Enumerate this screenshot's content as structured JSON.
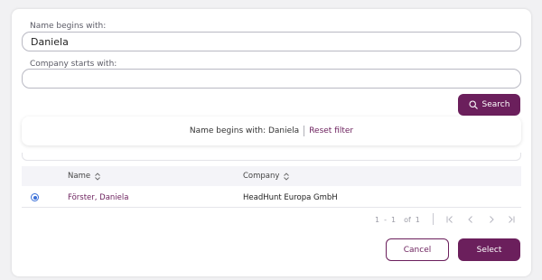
{
  "form": {
    "name_label": "Name begins with:",
    "name_value": "Daniela",
    "company_label": "Company starts with:",
    "company_value": "",
    "search_label": "Search"
  },
  "filter": {
    "text": "Name begins with: Daniela",
    "reset_label": "Reset filter"
  },
  "table": {
    "columns": [
      "Name",
      "Company"
    ],
    "rows": [
      {
        "selected": true,
        "name": "Förster, Daniela",
        "company": "HeadHunt Europa GmbH"
      }
    ]
  },
  "pagination": {
    "range_start": "1",
    "dash": "-",
    "range_end": "1",
    "of_label": "of",
    "total": "1"
  },
  "actions": {
    "cancel_label": "Cancel",
    "select_label": "Select"
  },
  "colors": {
    "accent": "#6b1f5c",
    "radio": "#3a6fd8"
  },
  "icons": [
    "search-icon",
    "sort-icon",
    "first-page-icon",
    "prev-page-icon",
    "next-page-icon",
    "last-page-icon"
  ]
}
